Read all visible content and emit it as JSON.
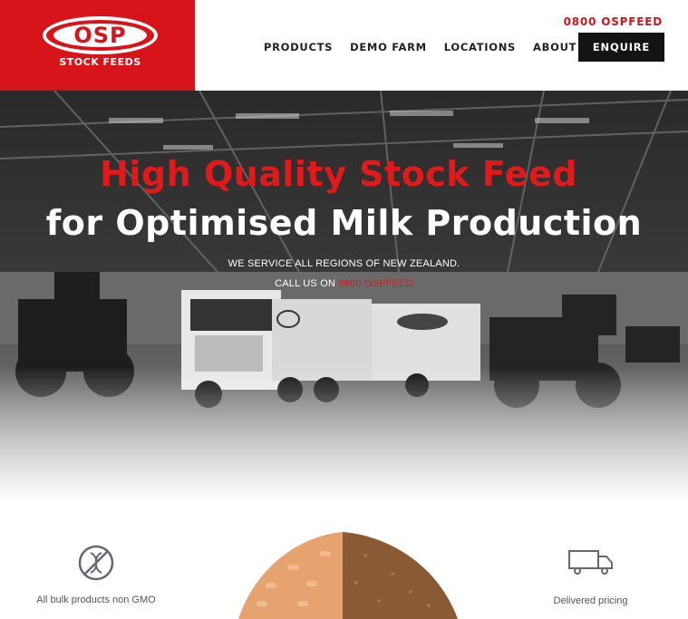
{
  "header": {
    "logo": {
      "word": "OSP",
      "subtitle": "STOCK FEEDS"
    },
    "phone": "0800 OSPFEED",
    "nav": [
      {
        "label": "PRODUCTS"
      },
      {
        "label": "DEMO FARM"
      },
      {
        "label": "LOCATIONS"
      },
      {
        "label": "ABOUT"
      }
    ],
    "cta_label": "ENQUIRE"
  },
  "hero": {
    "title_red": "High Quality Stock Feed",
    "title_white": "for Optimised Milk Production",
    "line1": "WE SERVICE ALL REGIONS OF NEW ZEALAND.",
    "line2_prefix": "CALL US ON",
    "line2_phone": "0800 OSPFEED",
    "truck_logo_text": "OSP",
    "truck_logo_sub": "STOCK FEEDS"
  },
  "features": {
    "left": {
      "icon": "no-gmo-icon",
      "label": "All bulk products non GMO"
    },
    "right": {
      "icon": "delivery-truck-icon",
      "label": "Delivered pricing"
    }
  },
  "colors": {
    "brand_red": "#d7141a",
    "dark": "#141414"
  }
}
